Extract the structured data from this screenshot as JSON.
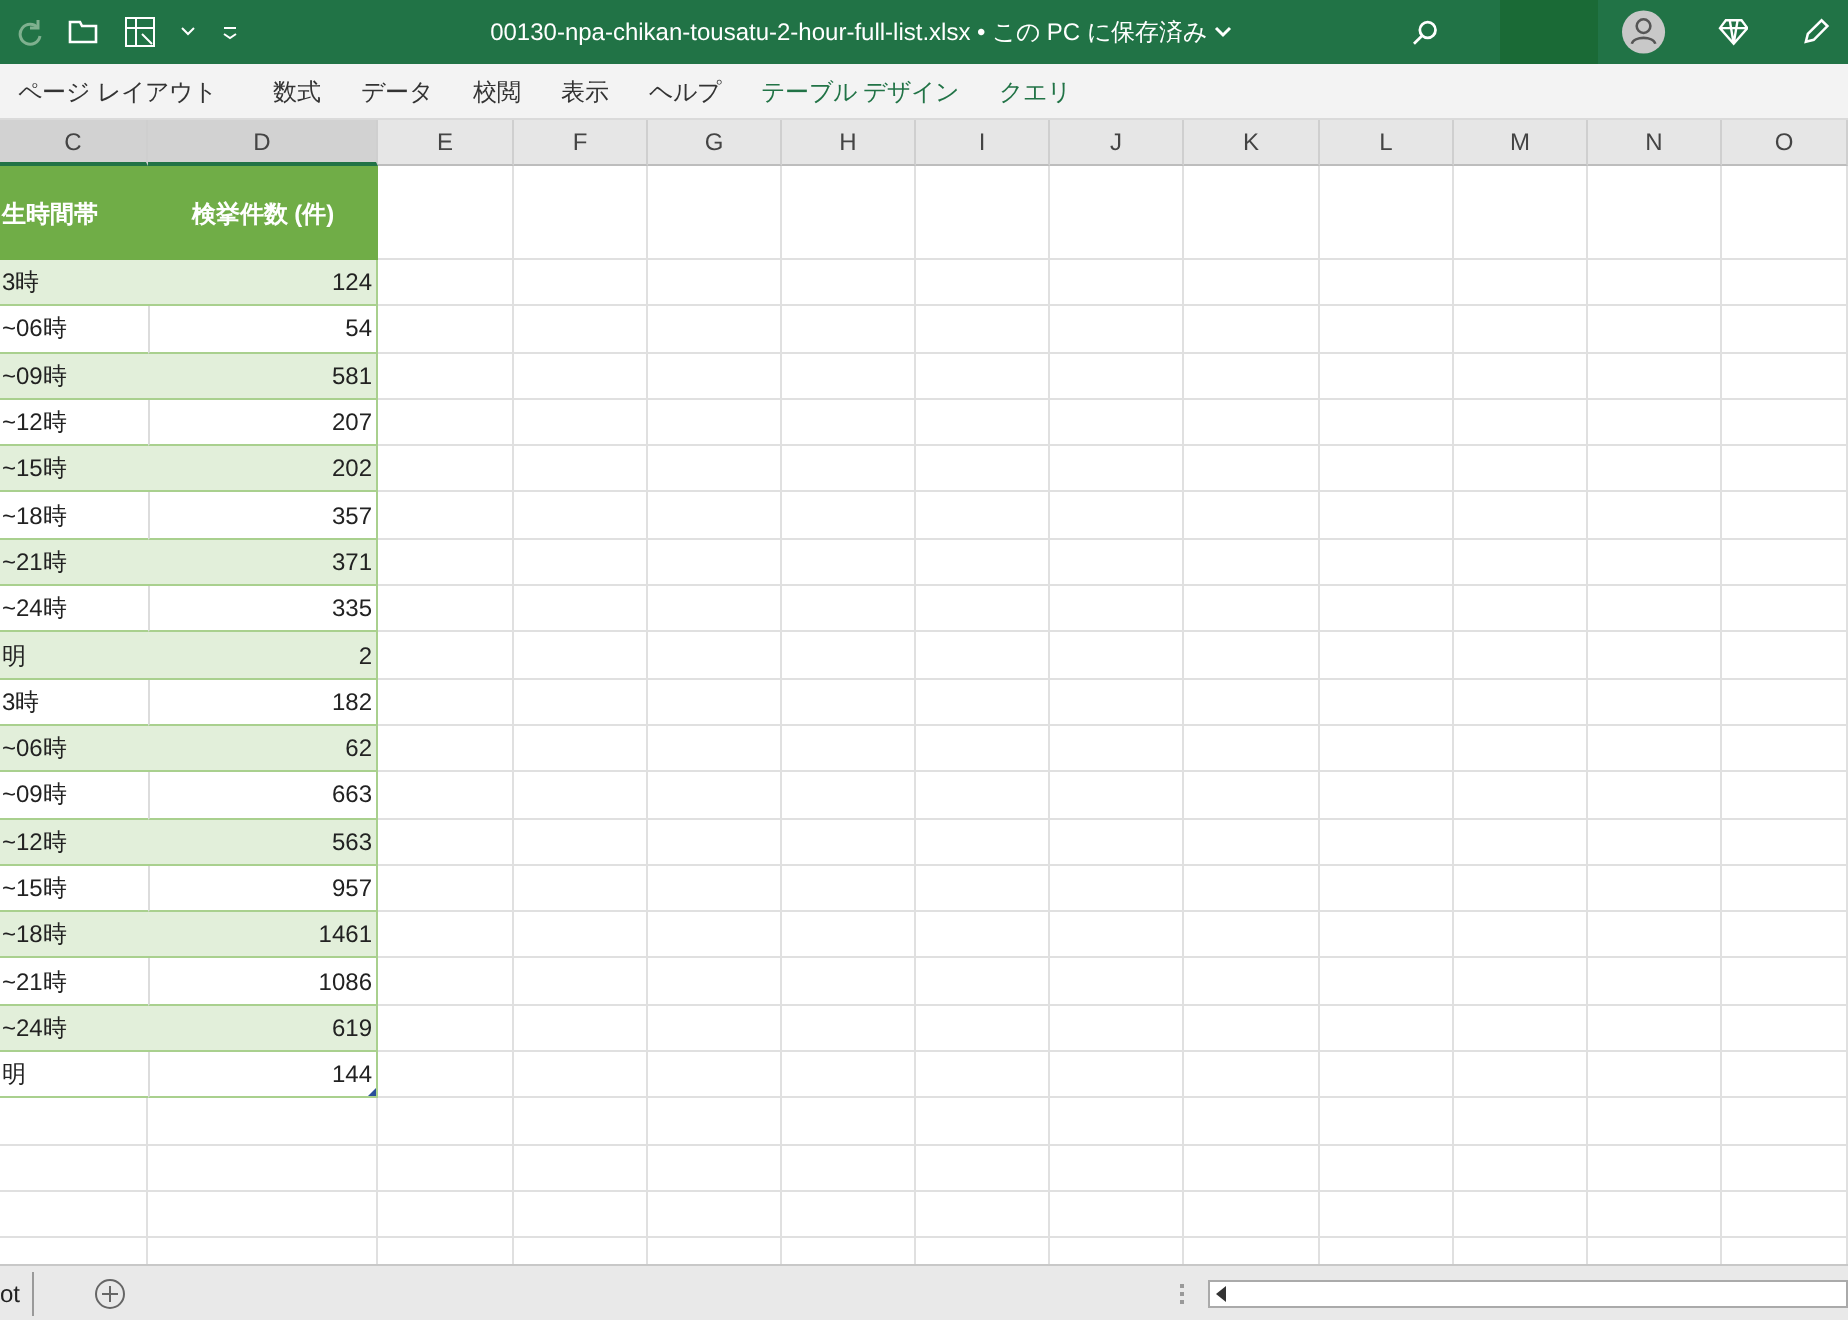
{
  "title_bar": {
    "title": "00130-npa-chikan-tousatu-2-hour-full-list.xlsx • この PC に保存済み"
  },
  "ribbon_tabs": [
    {
      "label": "ページ レイアウト",
      "kind": "normal"
    },
    {
      "label": "数式",
      "kind": "normal"
    },
    {
      "label": "データ",
      "kind": "normal"
    },
    {
      "label": "校閲",
      "kind": "normal"
    },
    {
      "label": "表示",
      "kind": "normal"
    },
    {
      "label": "ヘルプ",
      "kind": "normal"
    },
    {
      "label": "テーブル デザイン",
      "kind": "contextual"
    },
    {
      "label": "クエリ",
      "kind": "contextual"
    }
  ],
  "columns": [
    {
      "label": "C",
      "selected": true
    },
    {
      "label": "D",
      "selected": true
    },
    {
      "label": "E",
      "selected": false
    },
    {
      "label": "F",
      "selected": false
    },
    {
      "label": "G",
      "selected": false
    },
    {
      "label": "H",
      "selected": false
    },
    {
      "label": "I",
      "selected": false
    },
    {
      "label": "J",
      "selected": false
    },
    {
      "label": "K",
      "selected": false
    },
    {
      "label": "L",
      "selected": false
    },
    {
      "label": "M",
      "selected": false
    },
    {
      "label": "N",
      "selected": false
    },
    {
      "label": "O",
      "selected": false
    }
  ],
  "table": {
    "header": [
      "生時間帯",
      "検挙件数 (件)"
    ],
    "rows": [
      {
        "c": "3時",
        "d": "124"
      },
      {
        "c": "~06時",
        "d": "54"
      },
      {
        "c": "~09時",
        "d": "581"
      },
      {
        "c": "~12時",
        "d": "207"
      },
      {
        "c": "~15時",
        "d": "202"
      },
      {
        "c": "~18時",
        "d": "357"
      },
      {
        "c": "~21時",
        "d": "371"
      },
      {
        "c": "~24時",
        "d": "335"
      },
      {
        "c": "明",
        "d": "2"
      },
      {
        "c": "3時",
        "d": "182"
      },
      {
        "c": "~06時",
        "d": "62"
      },
      {
        "c": "~09時",
        "d": "663"
      },
      {
        "c": "~12時",
        "d": "563"
      },
      {
        "c": "~15時",
        "d": "957"
      },
      {
        "c": "~18時",
        "d": "1461"
      },
      {
        "c": "~21時",
        "d": "1086"
      },
      {
        "c": "~24時",
        "d": "619"
      },
      {
        "c": "明",
        "d": "144"
      }
    ]
  },
  "sheet_tab": {
    "label": "ot"
  }
}
